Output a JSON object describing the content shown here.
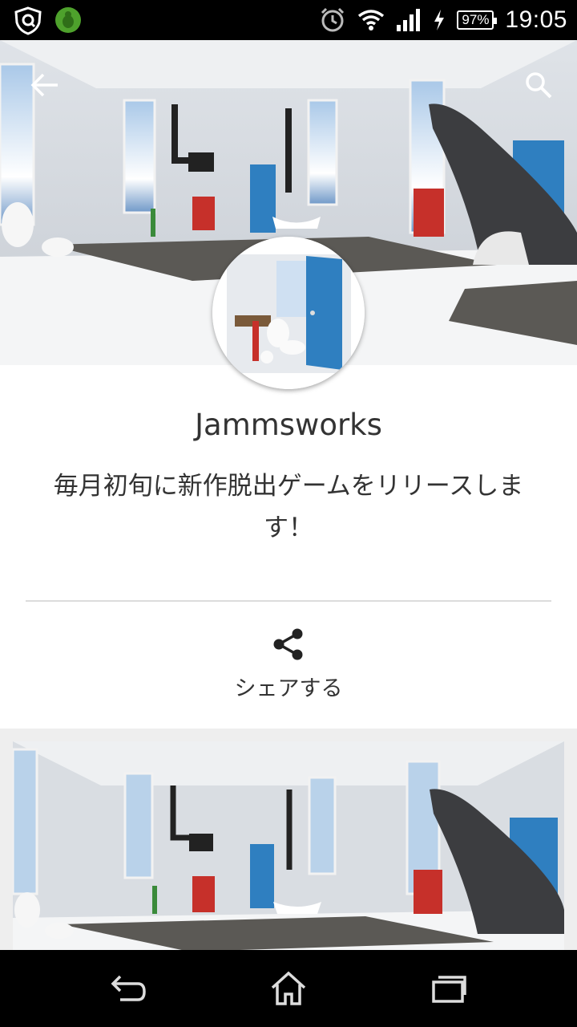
{
  "status_bar": {
    "time": "19:05",
    "battery": "97%",
    "icons": [
      "vpn-shield-icon",
      "bug-shield-icon",
      "alarm-icon",
      "wifi-icon",
      "signal-icon",
      "charging-icon",
      "battery-icon"
    ]
  },
  "header": {
    "back_icon": "arrow-left-icon",
    "search_icon": "search-icon"
  },
  "developer": {
    "name": "Jammsworks",
    "description": "毎月初旬に新作脱出ゲームをリリースします！"
  },
  "share": {
    "icon": "share-icon",
    "label": "シェアする"
  },
  "nav_bar": {
    "icons": [
      "back-icon",
      "home-icon",
      "recents-icon"
    ]
  },
  "colors": {
    "status_bar": "#000000",
    "text": "#333333",
    "divider": "#dcdcdc",
    "gallery_bg": "#eeeeee",
    "door_blue": "#2f7fc0"
  }
}
